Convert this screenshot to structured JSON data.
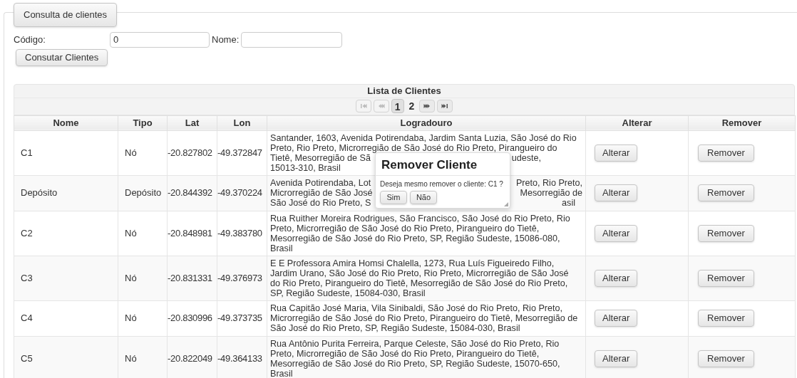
{
  "panel": {
    "legend": "Consulta de clientes"
  },
  "form": {
    "codigo_label": "Código:",
    "codigo_value": "0",
    "nome_label": "Nome:",
    "button": "Consutar Clientes"
  },
  "table": {
    "caption": "Lista de Clientes",
    "paginator": {
      "first_disabled": true,
      "prev_disabled": true,
      "pages": [
        {
          "label": "1",
          "selected": true
        },
        {
          "label": "2",
          "selected": false
        }
      ]
    },
    "columns": [
      "Nome",
      "Tipo",
      "Lat",
      "Lon",
      "Logradouro",
      "Alterar",
      "Remover"
    ],
    "rows": [
      {
        "nome": "C1",
        "tipo": "Nó",
        "lat": "-20.827802",
        "lon": "-49.372847",
        "alterar": "Alterar",
        "remover": "Remover",
        "logradouro": [
          {
            "text": "Santander, 1603, Avenida Potirendaba, Jardim Santa Luzia, São José do Rio"
          },
          {
            "text": "Preto, Rio Preto, Microrregião de São José do Rio Preto, Pirangueiro do"
          },
          {
            "text": "Tietê, Mesorregião de Sã",
            "right": "udeste,"
          },
          {
            "text": "15013-310, Brasil"
          }
        ]
      },
      {
        "nome": "Depósito",
        "tipo": "Depósito",
        "lat": "-20.844392",
        "lon": "-49.370224",
        "alterar": "Alterar",
        "remover": "Remover",
        "logradouro": [
          {
            "text": "Avenida Potirendaba, Lot",
            "right": "Preto, Rio Preto,"
          },
          {
            "text": "Microrregião de São José",
            "right": "Mesorregião de"
          },
          {
            "text": "São José do Rio Preto, S",
            "right": "asil"
          }
        ]
      },
      {
        "nome": "C2",
        "tipo": "Nó",
        "lat": "-20.848981",
        "lon": "-49.383780",
        "alterar": "Alterar",
        "remover": "Remover",
        "logradouro": [
          {
            "text": "Rua Ruither Moreira Rodrigues, São Francisco, São José do Rio Preto, Rio"
          },
          {
            "text": "Preto, Microrregião de São José do Rio Preto, Pirangueiro do Tietê,"
          },
          {
            "text": "Mesorregião de São José do Rio Preto, SP, Região Sudeste, 15086-080,"
          },
          {
            "text": "Brasil"
          }
        ]
      },
      {
        "nome": "C3",
        "tipo": "Nó",
        "lat": "-20.831331",
        "lon": "-49.376973",
        "alterar": "Alterar",
        "remover": "Remover",
        "logradouro": [
          {
            "text": "E E Professora Amira Homsi Chalella, 1273, Rua Luís Figueiredo Filho,"
          },
          {
            "text": "Jardim Urano, São José do Rio Preto, Rio Preto, Microrregião de São José"
          },
          {
            "text": "do Rio Preto, Pirangueiro do Tietê, Mesorregião de São José do Rio Preto,"
          },
          {
            "text": "SP, Região Sudeste, 15084-030, Brasil"
          }
        ]
      },
      {
        "nome": "C4",
        "tipo": "Nó",
        "lat": "-20.830996",
        "lon": "-49.373735",
        "alterar": "Alterar",
        "remover": "Remover",
        "logradouro": [
          {
            "text": "Rua Capitão José Maria, Vila Sinibaldi, São José do Rio Preto, Rio Preto,"
          },
          {
            "text": "Microrregião de São José do Rio Preto, Pirangueiro do Tietê, Mesorregião de"
          },
          {
            "text": "São José do Rio Preto, SP, Região Sudeste, 15084-030, Brasil"
          }
        ]
      },
      {
        "nome": "C5",
        "tipo": "Nó",
        "lat": "-20.822049",
        "lon": "-49.364133",
        "alterar": "Alterar",
        "remover": "Remover",
        "logradouro": [
          {
            "text": "Rua Antônio Purita Ferreira, Parque Celeste, São José do Rio Preto, Rio"
          },
          {
            "text": "Preto, Microrregião de São José do Rio Preto, Pirangueiro do Tietê,"
          },
          {
            "text": "Mesorregião de São José do Rio Preto, SP, Região Sudeste, 15070-650,"
          },
          {
            "text": "Brasil"
          }
        ]
      }
    ]
  },
  "dialog": {
    "title": "Remover Cliente",
    "message": "Deseja mesmo remover o cliente: C1 ?",
    "buttons": [
      "Sim",
      "Não"
    ]
  }
}
